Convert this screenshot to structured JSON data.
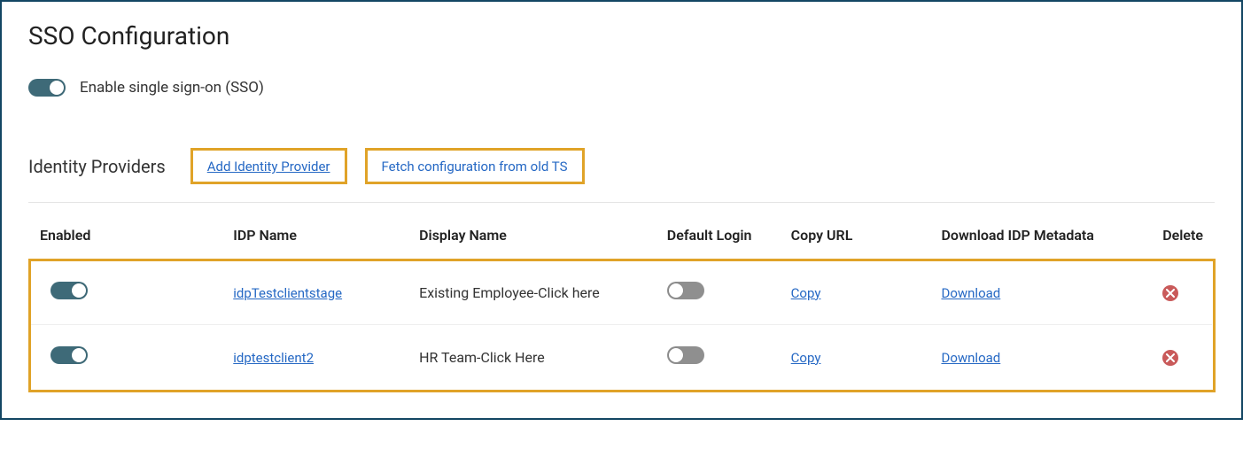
{
  "title": "SSO Configuration",
  "enable_sso_label": "Enable single sign-on (SSO)",
  "enable_sso_on": true,
  "providers_title": "Identity Providers",
  "add_provider_label": "Add Identity Provider",
  "fetch_old_ts_label": "Fetch configuration from old TS",
  "columns": {
    "enabled": "Enabled",
    "idp_name": "IDP Name",
    "display_name": "Display Name",
    "default_login": "Default Login",
    "copy_url": "Copy URL",
    "download_idp": "Download IDP Metadata",
    "delete": "Delete"
  },
  "rows": [
    {
      "enabled": true,
      "idp_name": "idpTestclientstage",
      "display_name": "Existing Employee-Click here",
      "default_login": false,
      "copy_label": "Copy",
      "download_label": "Download"
    },
    {
      "enabled": true,
      "idp_name": "idptestclient2",
      "display_name": "HR Team-Click Here",
      "default_login": false,
      "copy_label": "Copy",
      "download_label": "Download"
    }
  ]
}
